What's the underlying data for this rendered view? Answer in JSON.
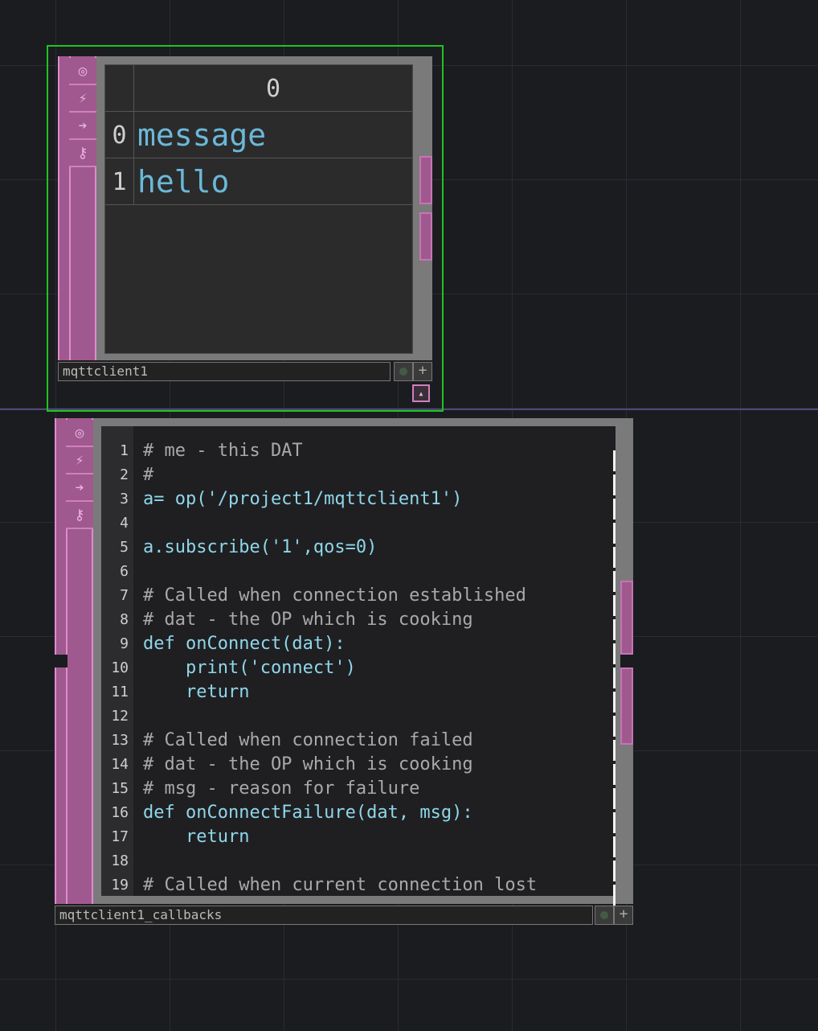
{
  "table_op": {
    "name": "mqttclient1",
    "header": "0",
    "rows": [
      {
        "index": "0",
        "value": "message"
      },
      {
        "index": "1",
        "value": "hello"
      }
    ]
  },
  "callbacks_op": {
    "name": "mqttclient1_callbacks",
    "lines": [
      {
        "n": "1",
        "text": "# me - this DAT",
        "kind": "comment"
      },
      {
        "n": "2",
        "text": "#",
        "kind": "comment"
      },
      {
        "n": "3",
        "text": "a= op('/project1/mqttclient1')",
        "kind": "code"
      },
      {
        "n": "4",
        "text": "",
        "kind": "code"
      },
      {
        "n": "5",
        "text": "a.subscribe('1',qos=0)",
        "kind": "code"
      },
      {
        "n": "6",
        "text": "",
        "kind": "code"
      },
      {
        "n": "7",
        "text": "# Called when connection established",
        "kind": "comment"
      },
      {
        "n": "8",
        "text": "# dat - the OP which is cooking",
        "kind": "comment"
      },
      {
        "n": "9",
        "text": "def onConnect(dat):",
        "kind": "code"
      },
      {
        "n": "10",
        "text": "    print('connect')",
        "kind": "code"
      },
      {
        "n": "11",
        "text": "    return",
        "kind": "code"
      },
      {
        "n": "12",
        "text": "",
        "kind": "code"
      },
      {
        "n": "13",
        "text": "# Called when connection failed",
        "kind": "comment"
      },
      {
        "n": "14",
        "text": "# dat - the OP which is cooking",
        "kind": "comment"
      },
      {
        "n": "15",
        "text": "# msg - reason for failure",
        "kind": "comment"
      },
      {
        "n": "16",
        "text": "def onConnectFailure(dat, msg):",
        "kind": "code"
      },
      {
        "n": "17",
        "text": "    return",
        "kind": "code"
      },
      {
        "n": "18",
        "text": "",
        "kind": "code"
      },
      {
        "n": "19",
        "text": "# Called when current connection lost",
        "kind": "comment"
      }
    ]
  },
  "flags": [
    {
      "icon": "bypass-icon",
      "glyph": "◎"
    },
    {
      "icon": "cook-icon",
      "glyph": "⚡"
    },
    {
      "icon": "export-icon",
      "glyph": "➔"
    },
    {
      "icon": "lock-icon",
      "glyph": "🔓"
    }
  ],
  "colors": {
    "selection": "#1fc41f",
    "dat_strip": "#a0598e",
    "code_text": "#8fd6ea",
    "comment_text": "#a9a9a9",
    "background": "#1b1c20"
  }
}
